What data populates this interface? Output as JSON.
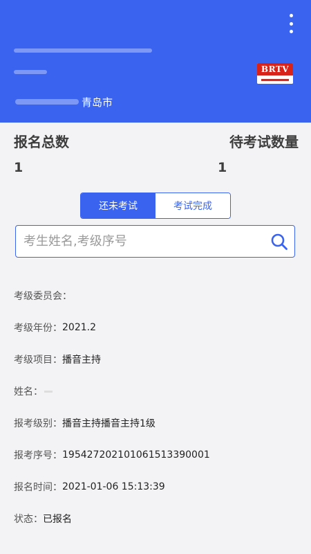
{
  "header": {
    "city_suffix": "青岛市",
    "logo_text": "BRTV"
  },
  "stats": {
    "total_label": "报名总数",
    "total_value": "1",
    "pending_label": "待考试数量",
    "pending_value": "1"
  },
  "tabs": [
    {
      "label": "还未考试",
      "active": true
    },
    {
      "label": "考试完成",
      "active": false
    }
  ],
  "search": {
    "placeholder": "考生姓名,考级序号"
  },
  "details": [
    {
      "label": "考级委员会：",
      "value": ""
    },
    {
      "label": "考级年份：",
      "value": "2021.2"
    },
    {
      "label": "考级项目：",
      "value": "播音主持"
    },
    {
      "label": "姓名：",
      "value": ""
    },
    {
      "label": "报考级别：",
      "value": "播音主持播音主持1级"
    },
    {
      "label": "报考序号：",
      "value": "195427202101061513390001"
    },
    {
      "label": "报名时间：",
      "value": "2021-01-06 15:13:39"
    },
    {
      "label": "状态：",
      "value": "已报名"
    }
  ],
  "colors": {
    "primary": "#3a63f0",
    "logo_red": "#d8231b"
  }
}
